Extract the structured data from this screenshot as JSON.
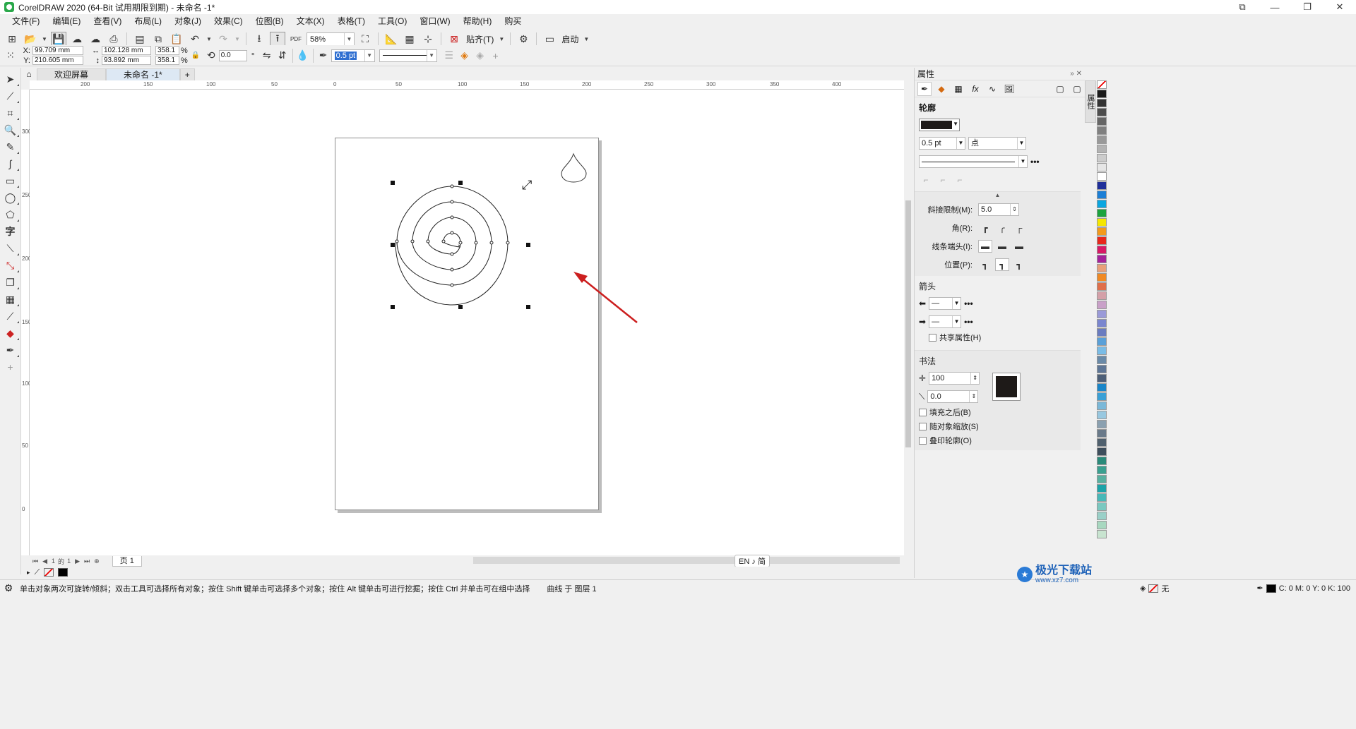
{
  "window": {
    "title": "CorelDRAW 2020 (64-Bit 试用期限到期) - 未命名 -1*",
    "buttons": [
      "⧉",
      "—",
      "❐",
      "✕"
    ]
  },
  "menu": [
    "文件(F)",
    "编辑(E)",
    "查看(V)",
    "布局(L)",
    "对象(J)",
    "效果(C)",
    "位图(B)",
    "文本(X)",
    "表格(T)",
    "工具(O)",
    "窗口(W)",
    "帮助(H)",
    "购买"
  ],
  "toolbar": {
    "zoom_value": "58%",
    "snap_label": "贴齐(T)",
    "launch_label": "启动"
  },
  "properties_bar": {
    "x_label": "X:",
    "x_value": "99.709 mm",
    "y_label": "Y:",
    "y_value": "210.605 mm",
    "width_value": "102.128 mm",
    "height_value": "93.892 mm",
    "scale_x": "358.1",
    "scale_y": "358.1",
    "percent": "%",
    "rotation": "0.0",
    "outline_width": "0.5 pt"
  },
  "tabs": {
    "welcome": "欢迎屏幕",
    "document": "未命名 -1*"
  },
  "ruler": {
    "h_labels": [
      "200",
      "150",
      "100",
      "50",
      "0",
      "50",
      "100",
      "150",
      "200",
      "250",
      "300",
      "350",
      "400"
    ],
    "v_labels": [
      "300",
      "250",
      "200",
      "150",
      "100",
      "50",
      "0"
    ]
  },
  "page_nav": {
    "current": "1",
    "of": "的",
    "total": "1",
    "page_tab": "页 1"
  },
  "ime": "EN ♪ 简",
  "status": {
    "hint": "单击对象两次可旋转/倾斜；双击工具可选择所有对象；按住 Shift 键单击可选择多个对象；按住 Alt 键单击可进行挖掘；按住 Ctrl 并单击可在组中选择",
    "object": "曲线 于 图层 1",
    "fill_none": "无",
    "cmyk": "C: 0 M: 0 Y: 0 K: 100"
  },
  "docker": {
    "title": "属性",
    "outline_section": "轮廓",
    "width": "0.5 pt",
    "unit": "点",
    "miter_label": "斜接限制(M):",
    "miter_value": "5.0",
    "corner_label": "角(R):",
    "cap_label": "线条端头(I):",
    "position_label": "位置(P):",
    "arrows_section": "箭头",
    "share_attr": "共享属性(H)",
    "calligraphy_section": "书法",
    "stretch_value": "100",
    "angle_value": "0.0",
    "fill_behind": "填充之后(B)",
    "scale_with_object": "随对象缩放(S)",
    "overprint": "叠印轮廓(O)",
    "side_tab": "属性"
  },
  "palette": [
    "#ffffff",
    "#1a1a1a",
    "#333333",
    "#4d4d4d",
    "#666666",
    "#808080",
    "#999999",
    "#b3b3b3",
    "#cccccc",
    "#e6e6e6",
    "#ffffff",
    "#1f2f9a",
    "#1c7fd6",
    "#0aa6e0",
    "#1ca33f",
    "#f5e700",
    "#f39a1b",
    "#e8271c",
    "#d81a66",
    "#a5239a",
    "#e8a07a",
    "#f08a24",
    "#e06f4a",
    "#d4a0a8",
    "#c9a0c8",
    "#9a9ad8",
    "#7a86cf",
    "#6a7cc0",
    "#5aa0d8",
    "#7abce6",
    "#6a8aa8",
    "#5e7696",
    "#4d5f78",
    "#1b86c8",
    "#3aa0d6",
    "#7ab8d8",
    "#98c8e0",
    "#8aa0b0",
    "#6a7a8a",
    "#50606e",
    "#3e4e5c",
    "#2a8a7a",
    "#3aa090",
    "#58b0a0",
    "#1ca3a8",
    "#48b8b8",
    "#7ac8c0",
    "#9ad0c8",
    "#a8d8c0",
    "#c8e4d0"
  ],
  "watermark": {
    "text": "极光下载站",
    "url": "www.xz7.com"
  },
  "colors": {
    "arrow": "#cc1f1f",
    "selected_tab": "#dde8f4",
    "outline_color": "#1e1a18"
  }
}
